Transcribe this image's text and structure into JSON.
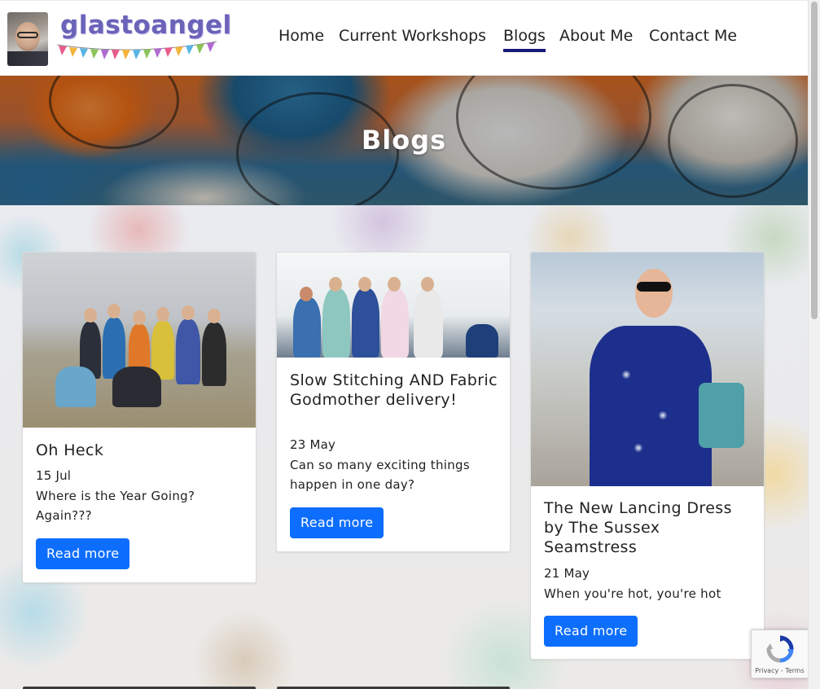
{
  "header": {
    "logo_text": "glastoangel",
    "avatar_alt": "profile photo",
    "nav": [
      {
        "label": "Home",
        "active": false
      },
      {
        "label": "Current Workshops",
        "active": false
      },
      {
        "label": "Blogs",
        "active": true
      },
      {
        "label": "About Me",
        "active": false
      },
      {
        "label": "Contact Me",
        "active": false
      }
    ]
  },
  "hero": {
    "title": "Blogs"
  },
  "posts": [
    {
      "title": "Oh Heck",
      "date": "15 Jul",
      "excerpt": "Where is the Year Going? Again???",
      "button": "Read more"
    },
    {
      "title": "Slow Stitching AND Fabric Godmother delivery!",
      "date": "23 May",
      "excerpt": "Can so many exciting things happen in one day?",
      "button": "Read more"
    },
    {
      "title": "The New Lancing Dress by The Sussex Seamstress",
      "date": "21 May",
      "excerpt": "When you're hot, you're hot",
      "button": "Read more"
    }
  ],
  "recaptcha": {
    "label": "Privacy - Terms"
  },
  "colors": {
    "button": "#0d6efd",
    "nav_active_underline": "#1a1a7a",
    "logo": "#6a63b8"
  }
}
